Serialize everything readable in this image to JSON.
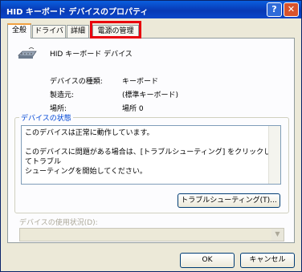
{
  "window": {
    "title": "HID キーボード デバイスのプロパティ"
  },
  "tabs": [
    "全般",
    "ドライバ",
    "詳細",
    "電源の管理"
  ],
  "device": {
    "name": "HID キーボード デバイス",
    "properties": [
      {
        "label": "デバイスの種類:",
        "value": "キーボード"
      },
      {
        "label": "製造元:",
        "value": "(標準キーボード)"
      },
      {
        "label": "場所:",
        "value": "場所 0"
      }
    ]
  },
  "status_group": {
    "label": "デバイスの状態",
    "line1": "このデバイスは正常に動作しています。",
    "line2": "このデバイスに問題がある場合は、[トラブルシューティング] をクリックしてトラブル",
    "line3": "シューティングを開始してください。"
  },
  "buttons": {
    "troubleshoot": "トラブルシューティング(T)...",
    "ok": "OK",
    "cancel": "キャンセル"
  },
  "usage": {
    "label": "デバイスの使用状況(D):",
    "value": ""
  },
  "colors": {
    "title_bar": "#0839b5",
    "highlight_box": "#e8000c",
    "group_label": "#0046d5"
  }
}
